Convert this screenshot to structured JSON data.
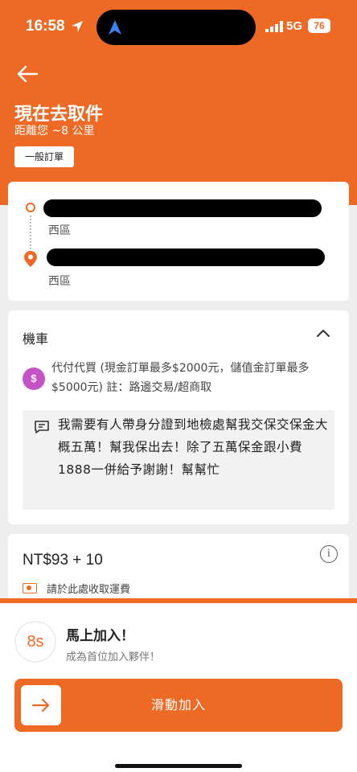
{
  "status_bar": {
    "time": "16:58",
    "network": "5G",
    "battery": "76"
  },
  "header": {
    "title": "現在去取件",
    "distance": "距離您 ~8 公里",
    "order_type": "一般訂單"
  },
  "route": {
    "pickup_district": "西區",
    "dropoff_district": "西區"
  },
  "details": {
    "vehicle": "機車",
    "payment_icon": "$",
    "payment_note": "代付代買 (現金訂單最多$2000元，儲值金訂單最多$5000元) 註：路邊交易/超商取",
    "customer_note": "我需要有人帶身分證到地檢處幫我交保交保金大概五萬！幫我保出去！除了五萬保金跟小費1888一併給予謝謝！幫幫忙"
  },
  "price": {
    "amount": "NT$93 + 10",
    "info_icon": "i",
    "collect_note": "請於此處收取運費"
  },
  "bottom": {
    "timer": "8s",
    "join_title": "馬上加入！",
    "join_subtitle": "成為首位加入夥伴！",
    "slide_label": "滑動加入"
  },
  "colors": {
    "brand": "#ee6a24",
    "payment_icon": "#c653c6"
  }
}
